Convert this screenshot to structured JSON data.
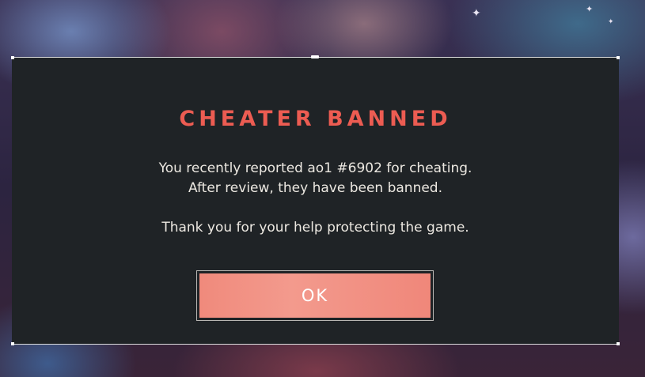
{
  "dialog": {
    "title": "CHEATER BANNED",
    "message_line1": "You recently reported ao1 #6902 for cheating.",
    "message_line2": "After review, they have been banned.",
    "thanks": "Thank you for your help protecting the game.",
    "ok_label": "OK"
  },
  "colors": {
    "title": "#ec5c52",
    "panel": "#1f2326",
    "button": "#f08a7c",
    "text": "#ece8e1"
  },
  "icons": {
    "sparkle": "sparkle-icon"
  }
}
